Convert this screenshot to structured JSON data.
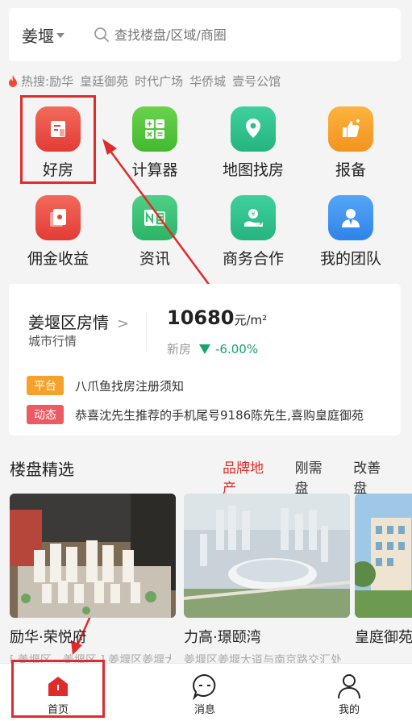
{
  "search": {
    "city": "姜堰",
    "placeholder": "查找楼盘/区域/商圈"
  },
  "hot": {
    "label": "热搜:",
    "tags": [
      "励华",
      "皇廷御苑",
      "时代广场",
      "华侨城",
      "壹号公馆"
    ]
  },
  "grid": [
    {
      "label": "好房",
      "icon": "house-card-icon",
      "color": "#e8443f"
    },
    {
      "label": "计算器",
      "icon": "calculator-icon",
      "color": "#55c43c"
    },
    {
      "label": "地图找房",
      "icon": "map-pin-icon",
      "color": "#2fbd8e"
    },
    {
      "label": "报备",
      "icon": "thumbs-up-icon",
      "color": "#f6a12b"
    },
    {
      "label": "佣金收益",
      "icon": "commission-icon",
      "color": "#ec4b42"
    },
    {
      "label": "资讯",
      "icon": "news-icon",
      "color": "#37be76"
    },
    {
      "label": "商务合作",
      "icon": "cooperation-icon",
      "color": "#2cbf83"
    },
    {
      "label": "我的团队",
      "icon": "team-icon",
      "color": "#3b8ff1"
    }
  ],
  "market": {
    "title": "姜堰区房情",
    "chevron": ">",
    "subtitle": "城市行情",
    "price": "10680",
    "unit": "元/m²",
    "new_label": "新房",
    "change": "-6.00%",
    "notices": [
      {
        "badge": "平台",
        "badge_color": "#f6a12b",
        "text": "八爪鱼找房注册须知"
      },
      {
        "badge": "动态",
        "badge_color": "#ec5a63",
        "text": "恭喜沈先生推荐的手机尾号9186陈先生,喜购皇庭御苑"
      }
    ]
  },
  "section": {
    "title": "楼盘精选",
    "tabs": [
      "品牌地产",
      "刚需盘",
      "改善盘"
    ]
  },
  "properties": [
    {
      "name": "励华·荣悦府",
      "addr": "[ 姜堰区 - 姜堰区 ] 姜堰区姜堰大道"
    },
    {
      "name": "力高·璟颐湾",
      "addr": "姜堰区姜堰大道与南京路交汇处"
    },
    {
      "name": "皇庭御苑",
      "addr": ""
    }
  ],
  "nav": [
    {
      "label": "首页",
      "icon": "home-icon"
    },
    {
      "label": "消息",
      "icon": "message-icon"
    },
    {
      "label": "我的",
      "icon": "user-icon"
    }
  ],
  "colors": {
    "accent": "#e02b2b",
    "green": "#18a46b"
  }
}
